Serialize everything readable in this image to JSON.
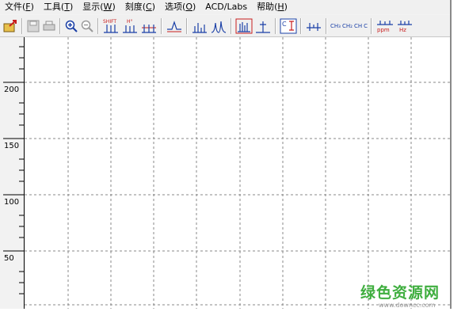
{
  "menu": [
    {
      "label": "文件",
      "key": "F"
    },
    {
      "label": "工具",
      "key": "T"
    },
    {
      "label": "显示",
      "key": "W"
    },
    {
      "label": "刻度",
      "key": "C"
    },
    {
      "label": "选项",
      "key": "O"
    },
    {
      "label": "ACD/Labs",
      "key": ""
    },
    {
      "label": "帮助",
      "key": "H"
    }
  ],
  "toolbar": {
    "shift_label": "SHIFT",
    "h_label": "H°",
    "ch3": "CH₃",
    "ch2": "CH₂",
    "ch": "CH",
    "c": "C",
    "ppm": "ppm",
    "hz": "Hz",
    "c_label": "C"
  },
  "axis": {
    "labels": [
      "200",
      "150",
      "100",
      "50"
    ]
  },
  "watermark": {
    "text": "绿色资源网",
    "url": "www.downcc.com"
  },
  "colors": {
    "grid": "#8a8a8a",
    "icon_blue": "#1a3fa6",
    "icon_red": "#c81e1e",
    "watermark": "#3fae3f"
  }
}
